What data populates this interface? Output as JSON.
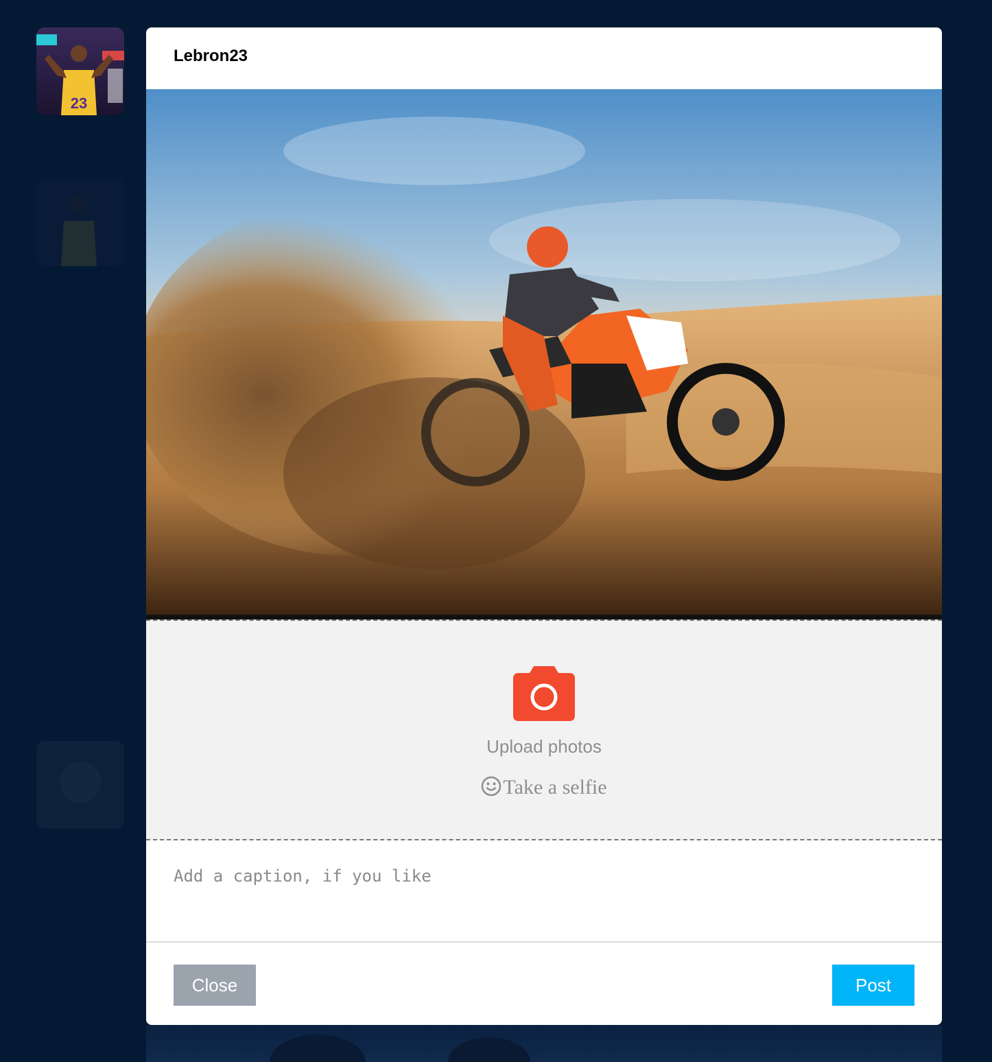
{
  "post_modal": {
    "username": "Lebron23",
    "upload_label": "Upload photos",
    "selfie_label": "Take a selfie",
    "caption_placeholder": "Add a caption, if you like",
    "close_label": "Close",
    "post_label": "Post"
  },
  "colors": {
    "background": "#041933",
    "camera_icon": "#f24a2f",
    "close_button": "#9ba3ad",
    "post_button": "#00b4f8"
  },
  "icons": {
    "camera": "camera-icon",
    "selfie": "smiley-icon"
  }
}
